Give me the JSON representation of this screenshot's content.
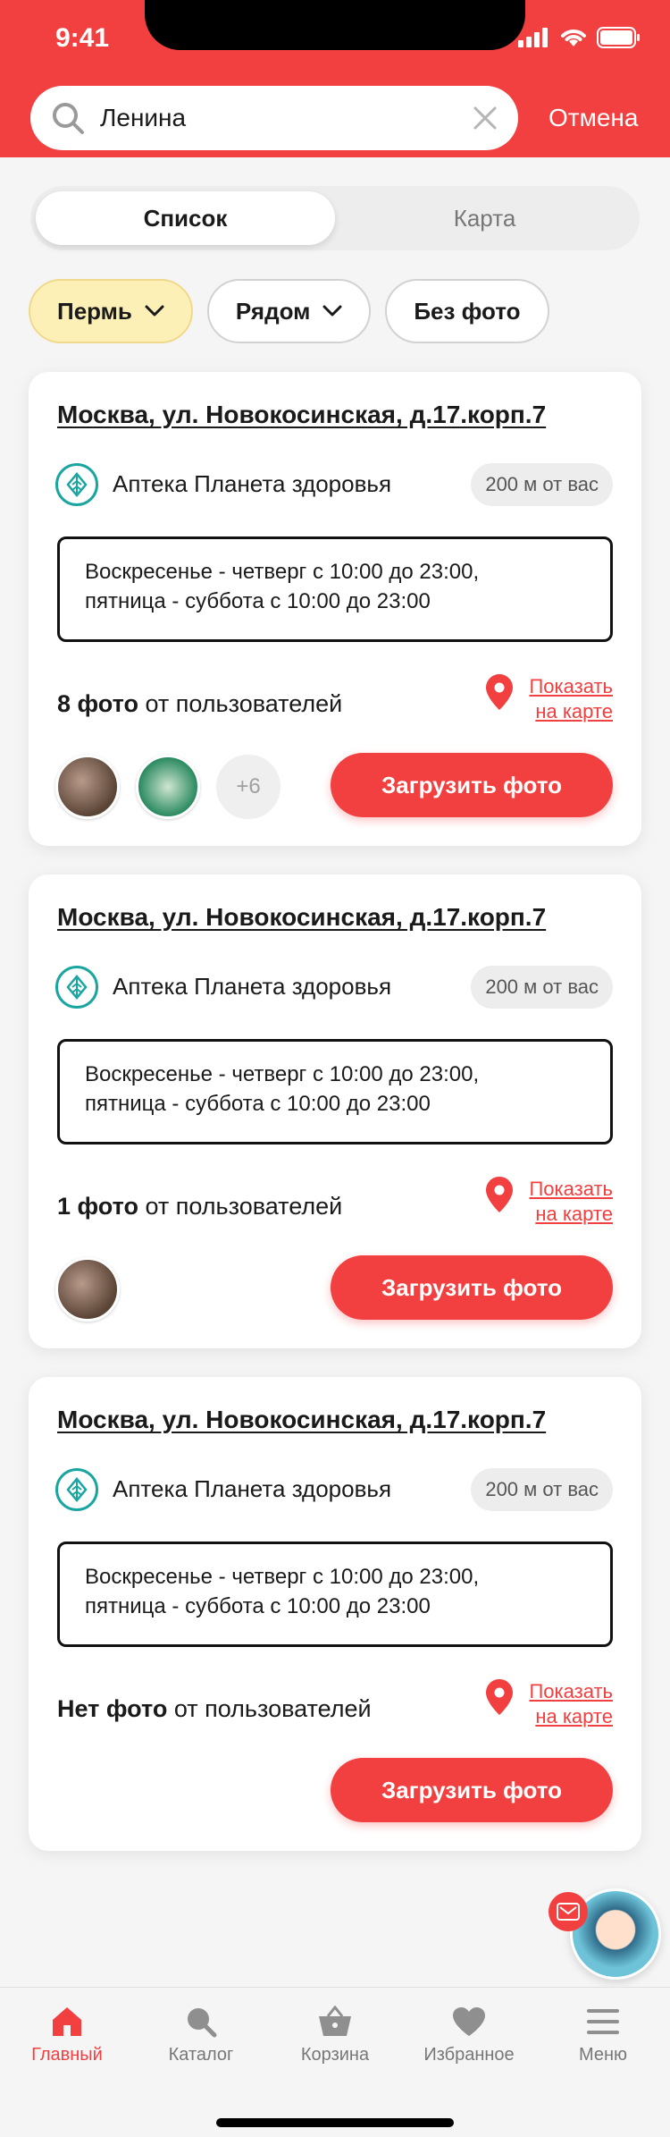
{
  "status_bar": {
    "time": "9:41"
  },
  "search": {
    "query": "Ленина",
    "cancel_label": "Отмена"
  },
  "view_toggle": {
    "list_label": "Список",
    "map_label": "Карта"
  },
  "filters": [
    {
      "label": "Пермь",
      "active": true,
      "dropdown": true
    },
    {
      "label": "Рядом",
      "active": false,
      "dropdown": true
    },
    {
      "label": "Без фото",
      "active": false,
      "dropdown": false
    }
  ],
  "cards": [
    {
      "address": "Москва, ул. Новокосинская, д.17.корп.7",
      "pharmacy": "Аптека Планета здоровья",
      "distance": "200 м от вас",
      "hours_line1": "Воскресенье - четверг с 10:00 до 23:00,",
      "hours_line2": "пятница - суббота с 10:00 до 23:00",
      "photos_count": "8 фото",
      "photos_suffix": " от пользователей",
      "map_link_line1": "Показать",
      "map_link_line2": "на карте",
      "more_photos": "+6",
      "upload_label": "Загрузить фото"
    },
    {
      "address": "Москва, ул. Новокосинская, д.17.корп.7",
      "pharmacy": "Аптека Планета здоровья",
      "distance": "200 м от вас",
      "hours_line1": "Воскресенье - четверг с 10:00 до 23:00,",
      "hours_line2": "пятница - суббота с 10:00 до 23:00",
      "photos_count": "1 фото",
      "photos_suffix": " от пользователей",
      "map_link_line1": "Показать",
      "map_link_line2": "на карте",
      "upload_label": "Загрузить фото"
    },
    {
      "address": "Москва, ул. Новокосинская, д.17.корп.7",
      "pharmacy": "Аптека Планета здоровья",
      "distance": "200 м от вас",
      "hours_line1": "Воскресенье - четверг с 10:00 до 23:00,",
      "hours_line2": "пятница - суббота с 10:00 до 23:00",
      "photos_count": "Нет фото",
      "photos_suffix": " от пользователей",
      "map_link_line1": "Показать",
      "map_link_line2": "на карте",
      "upload_label": "Загрузить фото"
    }
  ],
  "tabbar": [
    {
      "label": "Главный",
      "icon": "home-icon",
      "active": true
    },
    {
      "label": "Каталог",
      "icon": "search-icon",
      "active": false
    },
    {
      "label": "Корзина",
      "icon": "basket-icon",
      "active": false
    },
    {
      "label": "Избранное",
      "icon": "heart-icon",
      "active": false
    },
    {
      "label": "Меню",
      "icon": "menu-icon",
      "active": false
    }
  ],
  "colors": {
    "accent": "#f23f3f",
    "chip_active": "#fdf0b7",
    "pharmacy_teal": "#1aa5a0"
  }
}
